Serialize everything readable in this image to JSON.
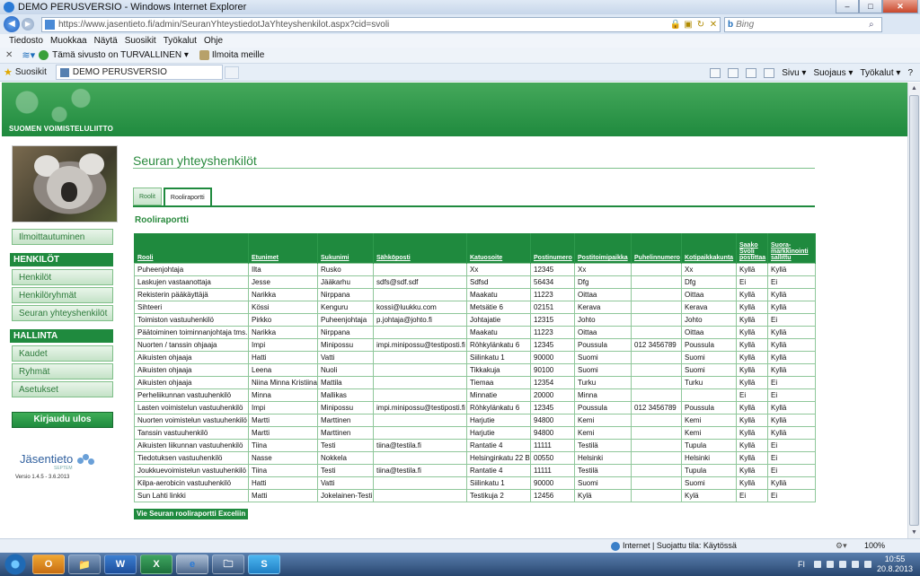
{
  "window": {
    "title": "DEMO PERUSVERSIO - Windows Internet Explorer",
    "min": "–",
    "max": "□",
    "close": "✕"
  },
  "address": {
    "url": "https://www.jasentieto.fi/admin/SeuranYhteystiedotJaYhteyshenkilot.aspx?cid=svoli",
    "search_placeholder": "Bing"
  },
  "menu": [
    "Tiedosto",
    "Muokkaa",
    "Näytä",
    "Suosikit",
    "Työkalut",
    "Ohje"
  ],
  "toolbar": {
    "safe_site": "Tämä sivusto on TURVALLINEN",
    "report": "Ilmoita meille"
  },
  "favorites": {
    "label": "Suosikit",
    "tab_title": "DEMO PERUSVERSIO",
    "commands": [
      "Sivu ▾",
      "Suojaus ▾",
      "Työkalut ▾",
      "?"
    ]
  },
  "site": {
    "brand": "SUOMEN VOIMISTELULIITTO",
    "page_title": "Seuran yhteyshenkilöt",
    "tabs": [
      {
        "label": "Roolit",
        "active": false
      },
      {
        "label": "Rooliraportti",
        "active": true
      }
    ],
    "section_title": "Rooliraportti",
    "export_button": "Vie Seuran rooliraportti Exceliin"
  },
  "sidebar": {
    "ilmoittautuminen": "Ilmoittautuminen",
    "henkilot_head": "HENKILÖT",
    "henkilot": "Henkilöt",
    "henkiloryhmat": "Henkilöryhmät",
    "seuran_yhteyshenkilot": "Seuran yhteyshenkilöt",
    "hallinta_head": "HALLINTA",
    "kaudet": "Kaudet",
    "ryhmat": "Ryhmät",
    "asetukset": "Asetukset",
    "login": "Kirjaudu ulos",
    "logo": "Jäsentieto",
    "logo_sub": "SEPTEM",
    "version": "Versio 1.4.5 - 3.6.2013"
  },
  "table": {
    "headers": [
      "Rooli",
      "Etunimet",
      "Sukunimi",
      "Sähköposti",
      "Katuosoite",
      "Postinumero",
      "Postitoimipaikka",
      "Puhelinnumero",
      "Kotipaikkakunta",
      "Saako Svoli postittaa",
      "Suora-markkinointi sallittu"
    ],
    "rows": [
      [
        "Puheenjohtaja",
        "Ilta",
        "Rusko",
        "",
        "Xx",
        "12345",
        "Xx",
        "",
        "Xx",
        "Kyllä",
        "Kyllä"
      ],
      [
        "Laskujen vastaanottaja",
        "Jesse",
        "Jääkarhu",
        "sdfs@sdf.sdf",
        "Sdfsd",
        "56434",
        "Dfg",
        "",
        "Dfg",
        "Ei",
        "Ei"
      ],
      [
        "Rekisterin pääkäyttäjä",
        "Narikka",
        "Nirppana",
        "",
        "Maakatu",
        "11223",
        "Oittaa",
        "",
        "Oittaa",
        "Kyllä",
        "Kyllä"
      ],
      [
        "Sihteeri",
        "Kössi",
        "Kenguru",
        "kossi@luukku.com",
        "Metsätie 6",
        "02151",
        "Kerava",
        "",
        "Kerava",
        "Kyllä",
        "Kyllä"
      ],
      [
        "Toimiston vastuuhenkilö",
        "Pirkko",
        "Puheenjohtaja",
        "p.johtaja@johto.fi",
        "Johtajatie",
        "12315",
        "Johto",
        "",
        "Johto",
        "Kyllä",
        "Ei"
      ],
      [
        "Päätoiminen toiminnanjohtaja tms.",
        "Narikka",
        "Nirppana",
        "",
        "Maakatu",
        "11223",
        "Oittaa",
        "",
        "Oittaa",
        "Kyllä",
        "Kyllä"
      ],
      [
        "Nuorten / tanssin ohjaaja",
        "Impi",
        "Minipossu",
        "impi.minipossu@testiposti.fi",
        "Röhkylänkatu 6",
        "12345",
        "Poussula",
        "012 3456789",
        "Poussula",
        "Kyllä",
        "Kyllä"
      ],
      [
        "Aikuisten ohjaaja",
        "Hatti",
        "Vatti",
        "",
        "Siilinkatu 1",
        "90000",
        "Suomi",
        "",
        "Suomi",
        "Kyllä",
        "Kyllä"
      ],
      [
        "Aikuisten ohjaaja",
        "Leena",
        "Nuoli",
        "",
        "Tikkakuja",
        "90100",
        "Suomi",
        "",
        "Suomi",
        "Kyllä",
        "Kyllä"
      ],
      [
        "Aikuisten ohjaaja",
        "Niina Minna Kristiina",
        "Mattila",
        "",
        "Tiemaa",
        "12354",
        "Turku",
        "",
        "Turku",
        "Kyllä",
        "Ei"
      ],
      [
        "Perheliikunnan vastuuhenkilö",
        "Minna",
        "Mallikas",
        "",
        "Minnatie",
        "20000",
        "Minna",
        "",
        "",
        "Ei",
        "Ei"
      ],
      [
        "Lasten voimistelun vastuuhenkilö",
        "Impi",
        "Minipossu",
        "impi.minipossu@testiposti.fi",
        "Röhkylänkatu 6",
        "12345",
        "Poussula",
        "012 3456789",
        "Poussula",
        "Kyllä",
        "Kyllä"
      ],
      [
        "Nuorten voimistelun vastuuhenkilö",
        "Martti",
        "Marttinen",
        "",
        "Harjutie",
        "94800",
        "Kemi",
        "",
        "Kemi",
        "Kyllä",
        "Kyllä"
      ],
      [
        "Tanssin vastuuhenkilö",
        "Martti",
        "Marttinen",
        "",
        "Harjutie",
        "94800",
        "Kemi",
        "",
        "Kemi",
        "Kyllä",
        "Kyllä"
      ],
      [
        "Aikuisten liikunnan vastuuhenkilö",
        "Tiina",
        "Testi",
        "tiina@testila.fi",
        "Rantatie 4",
        "11111",
        "Testilä",
        "",
        "Tupula",
        "Kyllä",
        "Ei"
      ],
      [
        "Tiedotuksen vastuuhenkilö",
        "Nasse",
        "Nokkela",
        "",
        "Helsinginkatu 22 B",
        "00550",
        "Helsinki",
        "",
        "Helsinki",
        "Kyllä",
        "Ei"
      ],
      [
        "Joukkuevoimistelun vastuuhenkilö",
        "Tiina",
        "Testi",
        "tiina@testila.fi",
        "Rantatie 4",
        "11111",
        "Testilä",
        "",
        "Tupula",
        "Kyllä",
        "Ei"
      ],
      [
        "Kilpa-aerobicin vastuuhenkilö",
        "Hatti",
        "Vatti",
        "",
        "Siilinkatu 1",
        "90000",
        "Suomi",
        "",
        "Suomi",
        "Kyllä",
        "Kyllä"
      ],
      [
        "Sun Lahti linkki",
        "Matti",
        "Jokelainen-Testi",
        "",
        "Testikuja 2",
        "12456",
        "Kylä",
        "",
        "Kylä",
        "Ei",
        "Ei"
      ]
    ]
  },
  "status": {
    "zone": "Internet | Suojattu tila: Käytössä",
    "zoom": "100%"
  },
  "taskbar": {
    "apps": [
      "O",
      "📁",
      "W",
      "X",
      "e",
      "🗀",
      "S"
    ],
    "lang": "FI",
    "time": "10:55",
    "date": "20.8.2013"
  }
}
